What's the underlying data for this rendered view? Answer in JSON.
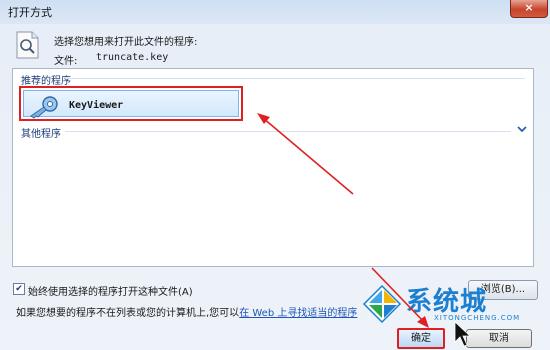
{
  "window": {
    "title": "打开方式",
    "close_label": "×"
  },
  "header": {
    "prompt": "选择您想用来打开此文件的程序:",
    "file_label": "文件:",
    "file_name": "truncate.key"
  },
  "program_list": {
    "recommended_header": "推荐的程序",
    "recommended_items": [
      {
        "label": "KeyViewer",
        "icon": "key-viewer-icon",
        "selected": true
      }
    ],
    "other_header": "其他程序",
    "expand_icon": "chevron-down-icon"
  },
  "options": {
    "always_use_label": "始终使用选择的程序打开这种文件(A)",
    "always_use_checked": true,
    "browse_label": "浏览(B)..."
  },
  "hint": {
    "text": "如果您想要的程序不在列表或您的计算机上,您可以",
    "link": "在 Web 上寻找适当的程序"
  },
  "buttons": {
    "ok_label": "确定",
    "cancel_label": "取消"
  },
  "watermark": {
    "brand": "系统城",
    "sub": "XITONGCHENG.COM"
  },
  "colors": {
    "highlight_red": "#e02020",
    "link_blue": "#1f55b8",
    "selection_blue": "#d3e8fc"
  }
}
